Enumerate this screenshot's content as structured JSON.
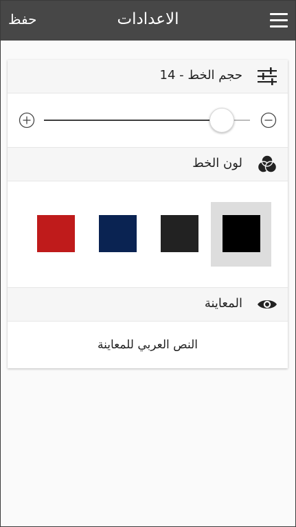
{
  "app_bar": {
    "title": "الاعدادات",
    "save_label": "حفظ",
    "menu_icon": "hamburger-menu-icon"
  },
  "font_size": {
    "label": "حجم الخط - 14",
    "icon": "sliders-icon",
    "value": 14,
    "slider_fraction": 0.89,
    "increase_icon": "plus-circle-icon",
    "decrease_icon": "minus-circle-icon"
  },
  "font_color": {
    "label": "لون الخط",
    "icon": "color-circles-icon",
    "swatches": [
      {
        "color": "#000000",
        "selected": true
      },
      {
        "color": "#222222",
        "selected": false
      },
      {
        "color": "#0a2352",
        "selected": false
      },
      {
        "color": "#bf1b1b",
        "selected": false
      }
    ]
  },
  "preview": {
    "label": "المعاينة",
    "icon": "eye-icon",
    "text": "النص العربي للمعاينة"
  }
}
